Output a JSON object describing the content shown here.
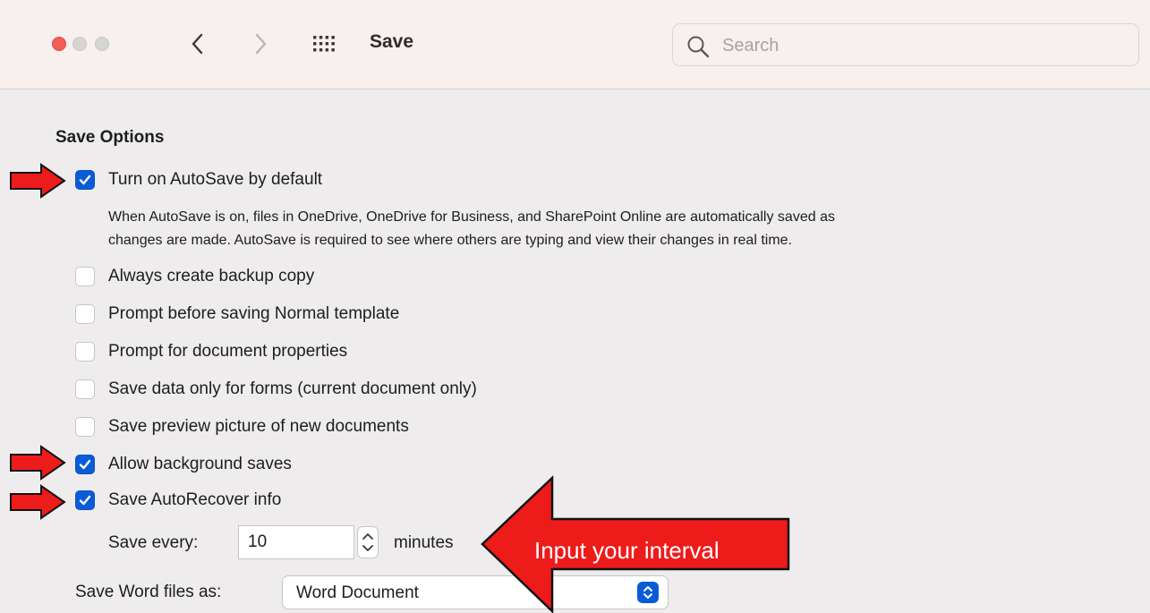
{
  "window": {
    "title": "Save",
    "search_placeholder": "Search"
  },
  "section": {
    "title": "Save Options"
  },
  "options": {
    "autosave": {
      "label": "Turn on AutoSave by default",
      "checked": true
    },
    "autosave_description": [
      "When AutoSave is on, files in OneDrive, OneDrive for Business, and SharePoint Online are automatically saved as",
      "changes are made. AutoSave is required to see where others are typing and view their changes in real time."
    ],
    "backup": {
      "label": "Always create backup copy",
      "checked": false
    },
    "prompt_normal": {
      "label": "Prompt before saving Normal template",
      "checked": false
    },
    "prompt_properties": {
      "label": "Prompt for document properties",
      "checked": false
    },
    "forms_only": {
      "label": "Save data only for forms (current document only)",
      "checked": false
    },
    "preview_picture": {
      "label": "Save preview picture of new documents",
      "checked": false
    },
    "background_saves": {
      "label": "Allow background saves",
      "checked": true
    },
    "autorecover": {
      "label": "Save AutoRecover info",
      "checked": true
    }
  },
  "autorecover_interval": {
    "label": "Save every:",
    "value": "10",
    "unit": "minutes"
  },
  "file_format": {
    "label": "Save Word files as:",
    "value": "Word Document"
  },
  "annotation": {
    "callout_text": "Input your interval",
    "color": "#ee1b1b"
  },
  "colors": {
    "accent": "#0a5bd8",
    "close_button": "#f25e58",
    "titlebar_bg": "#f8efef",
    "content_bg": "#eeeced"
  },
  "icons": {
    "close": "close-traffic-light-icon",
    "minimize": "minimize-traffic-light-icon",
    "zoom": "zoom-traffic-light-icon",
    "back": "chevron-left-icon",
    "forward": "chevron-right-icon",
    "show_all": "grid-icon",
    "search": "magnifier-icon",
    "stepper": "stepper-icon",
    "popup": "popup-chevron-icon",
    "annotation_arrow": "red-arrow-icon"
  }
}
